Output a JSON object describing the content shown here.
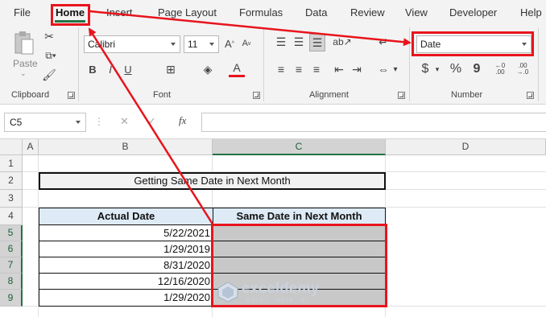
{
  "ribbon_tabs": [
    "File",
    "Home",
    "Insert",
    "Page Layout",
    "Formulas",
    "Data",
    "Review",
    "View",
    "Developer",
    "Help"
  ],
  "clipboard": {
    "paste_label": "Paste",
    "group_label": "Clipboard"
  },
  "font": {
    "family": "Calibri",
    "size": "11",
    "group_label": "Font",
    "bold": "B",
    "italic": "I",
    "underline": "U"
  },
  "alignment": {
    "group_label": "Alignment"
  },
  "number": {
    "format": "Date",
    "currency": "$",
    "percent": "%",
    "comma": "9",
    "group_label": "Number"
  },
  "formula_bar": {
    "cell_ref": "C5",
    "cancel": "✕",
    "enter": "✓",
    "fx": "fx",
    "content": ""
  },
  "columns": [
    "A",
    "B",
    "C",
    "D"
  ],
  "rows": [
    "1",
    "2",
    "3",
    "4",
    "5",
    "6",
    "7",
    "8",
    "9"
  ],
  "sheet": {
    "title": "Getting Same Date in Next Month",
    "header_actual": "Actual Date",
    "header_same": "Same Date in Next Month",
    "dates": [
      "5/22/2021",
      "1/29/2019",
      "8/31/2020",
      "12/16/2020",
      "1/29/2020"
    ]
  },
  "watermark": {
    "name": "exceldemy",
    "tagline": "EXCEL · DATA · BI"
  },
  "colors": {
    "accent": "#217346",
    "highlight": "#e8141c",
    "header_fill": "#deebf7",
    "selected_fill": "#c8c8c8"
  }
}
